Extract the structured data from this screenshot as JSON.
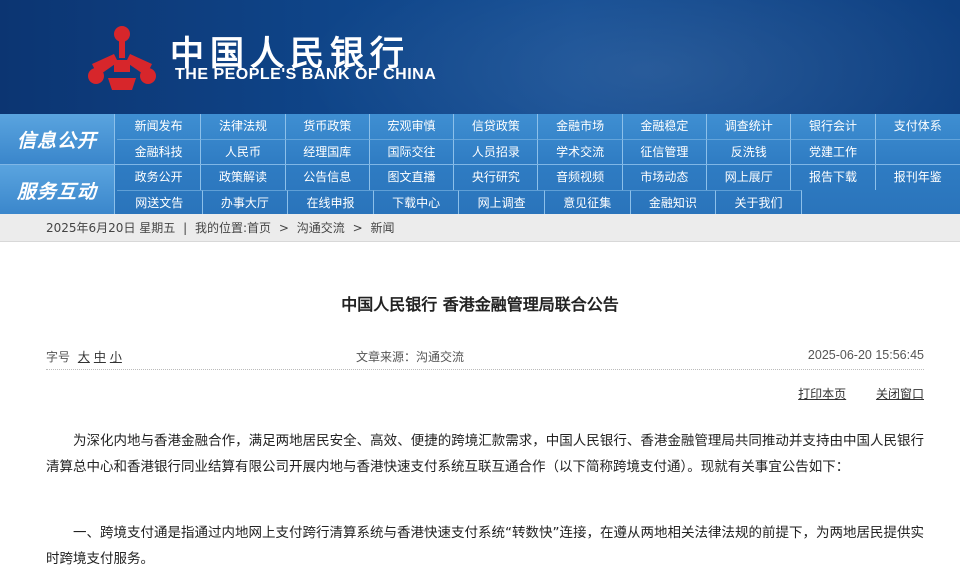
{
  "header": {
    "title_cn": "中国人民银行",
    "title_en": "THE PEOPLE'S BANK OF CHINA",
    "logo_color": "#d7262b"
  },
  "nav": {
    "section1_title": "信息公开",
    "section1_row1": [
      "新闻发布",
      "法律法规",
      "货币政策",
      "宏观审慎",
      "信贷政策",
      "金融市场",
      "金融稳定",
      "调查统计",
      "银行会计",
      "支付体系"
    ],
    "section1_row2": [
      "金融科技",
      "人民币",
      "经理国库",
      "国际交往",
      "人员招录",
      "学术交流",
      "征信管理",
      "反洗钱",
      "党建工作",
      ""
    ],
    "section2_title": "服务互动",
    "section2_row1": [
      "政务公开",
      "政策解读",
      "公告信息",
      "图文直播",
      "央行研究",
      "音频视频",
      "市场动态",
      "网上展厅",
      "报告下载",
      "报刊年鉴"
    ],
    "section2_row2": [
      "网送文告",
      "办事大厅",
      "在线申报",
      "下载中心",
      "网上调查",
      "意见征集",
      "金融知识",
      "关于我们",
      "",
      ""
    ]
  },
  "breadcrumb": {
    "date": "2025年6月20日 星期五",
    "location_label": "我的位置:",
    "items": [
      "首页",
      "沟通交流",
      "新闻"
    ],
    "separator": ">"
  },
  "article": {
    "title": "中国人民银行 香港金融管理局联合公告",
    "font_size_label": "字号",
    "font_size_options": [
      "大",
      "中",
      "小"
    ],
    "source": "文章来源：沟通交流",
    "datetime": "2025-06-20 15:56:45",
    "print_label": "打印本页",
    "close_label": "关闭窗口",
    "paragraphs": [
      "为深化内地与香港金融合作，满足两地居民安全、高效、便捷的跨境汇款需求，中国人民银行、香港金融管理局共同推动并支持由中国人民银行清算总中心和香港银行同业结算有限公司开展内地与香港快速支付系统互联互通合作（以下简称跨境支付通）。现就有关事宜公告如下：",
      "一、跨境支付通是指通过内地网上支付跨行清算系统与香港快速支付系统“转数快”连接，在遵从两地相关法律法规的前提下，为两地居民提供实时跨境支付服务。"
    ]
  }
}
